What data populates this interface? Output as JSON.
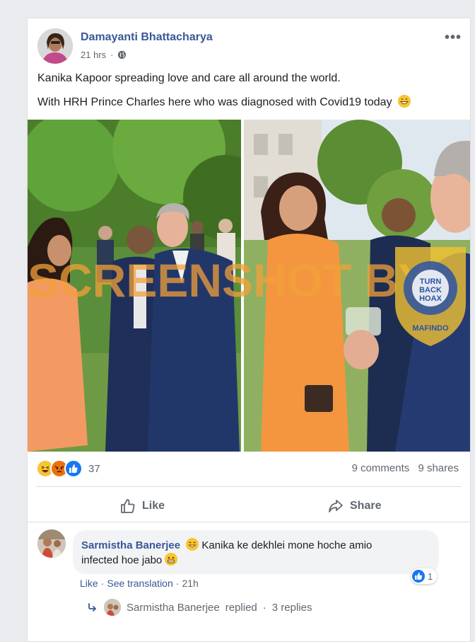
{
  "post": {
    "author": "Damayanti Bhattacharya",
    "time": "21 hrs",
    "privacy_icon": "globe-icon",
    "line1": "Kanika Kapoor spreading love and care all around the world.",
    "line2": "With HRH Prince Charles here who was diagnosed with Covid19 today",
    "line2_emoji": "grinning-face-emoji",
    "more_label": "•••"
  },
  "photo": {
    "watermark": "SCREENSHOT BY",
    "badge_line1": "TURN",
    "badge_line2": "BACK",
    "badge_line3": "HOAX",
    "badge_ring": "MASYARAKAT ANTI FITNAH INDONESIA",
    "badge_bottom": "MAFINDO"
  },
  "engagement": {
    "reaction_icons": [
      "haha-icon",
      "angry-icon",
      "like-icon"
    ],
    "reaction_count": "37",
    "comments": "9 comments",
    "shares": "9 shares"
  },
  "actions": {
    "like_label": "Like",
    "share_label": "Share"
  },
  "comment": {
    "author": "Sarmistha Banerjee",
    "text_part1": "Kanika ke dekhlei mone hoche amio",
    "text_part2": "infected hoe jabo",
    "like_count": "1",
    "like_action": "Like",
    "translate_action": "See translation",
    "time": "21h",
    "replies_author": "Sarmistha Banerjee",
    "replies_verb": "replied",
    "replies_count": "3 replies"
  },
  "colors": {
    "link_blue": "#385898",
    "facebook_blue": "#1877f2",
    "page_bg": "#e9ebee"
  }
}
